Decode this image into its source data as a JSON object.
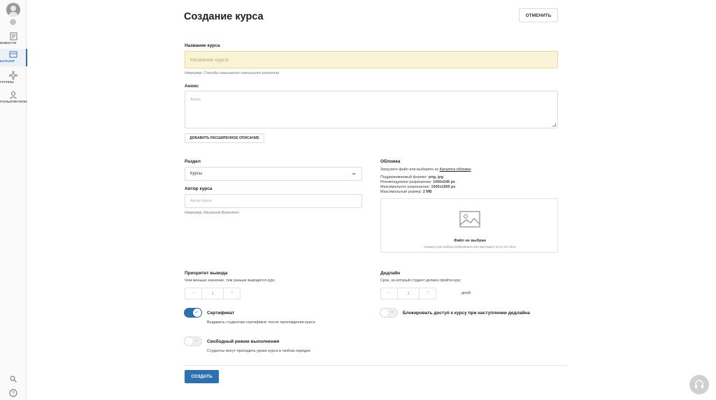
{
  "sidebar": {
    "items": [
      {
        "label": "НОВОСТИ",
        "icon": "news-icon"
      },
      {
        "label": "КАТАЛОГ",
        "icon": "catalog-icon",
        "active": true
      },
      {
        "label": "ГРУППЫ",
        "icon": "groups-icon"
      },
      {
        "label": "ПОЛЬЗОВАТЕЛИ",
        "icon": "users-icon"
      }
    ]
  },
  "header": {
    "title": "Создание курса",
    "cancel_label": "ОТМЕНИТЬ"
  },
  "form": {
    "course_name": {
      "label": "Название курса",
      "placeholder": "Название курса",
      "hint": "Например: Способы повышения лояльности клиентов"
    },
    "announce": {
      "label": "Анонс",
      "placeholder": "Анонс",
      "extended_button": "ДОБАВИТЬ РАСШИРЕННОЕ ОПИСАНИЕ"
    },
    "section": {
      "label": "Раздел",
      "value": "Курсы"
    },
    "author": {
      "label": "Автор курса",
      "placeholder": "Автор курса",
      "hint": "Например: Кашканов Валентин"
    },
    "cover": {
      "label": "Обложка",
      "intro": "Загрузите файл или выберите из",
      "catalog_link": "Каталога обложек",
      "format_label": "Поддерживаемый формат:",
      "format_value": "png, jpg",
      "recommended_label": "Рекомендуемое разрешение:",
      "recommended_value": "1000x545 px",
      "max_res_label": "Максимальное разрешение:",
      "max_res_value": "1000x1000 px",
      "max_size_label": "Максимальный размер:",
      "max_size_value": "2 MB",
      "no_file": "Файл не выбран",
      "upload_hint": "Нажмите для выбора изображения или перетащите его в этот блок"
    },
    "priority": {
      "label": "Приоритет вывода",
      "hint": "Чем меньше значение, тем раньше выводится курс",
      "value": "1",
      "minus": "−",
      "plus": "^"
    },
    "deadline": {
      "label": "Дедлайн",
      "hint": "Срок, за который студент должен пройти курс",
      "value": "1",
      "unit": "дней",
      "minus": "−",
      "plus": "^"
    },
    "certificate": {
      "label": "Сертификат",
      "description": "Выдавать студентам сертификат после прохождения курса",
      "enabled": true
    },
    "block_access": {
      "label": "Блокировать доступ к курсу при наступлении дедлайна",
      "enabled": false
    },
    "free_mode": {
      "label": "Свободный режим выполнения",
      "description": "Студенты могут проходить уроки курса в любом порядке",
      "enabled": false
    },
    "submit_label": "СОЗДАТЬ"
  },
  "colors": {
    "accent": "#2e6fad",
    "highlight_input": "#fbf3d5"
  }
}
